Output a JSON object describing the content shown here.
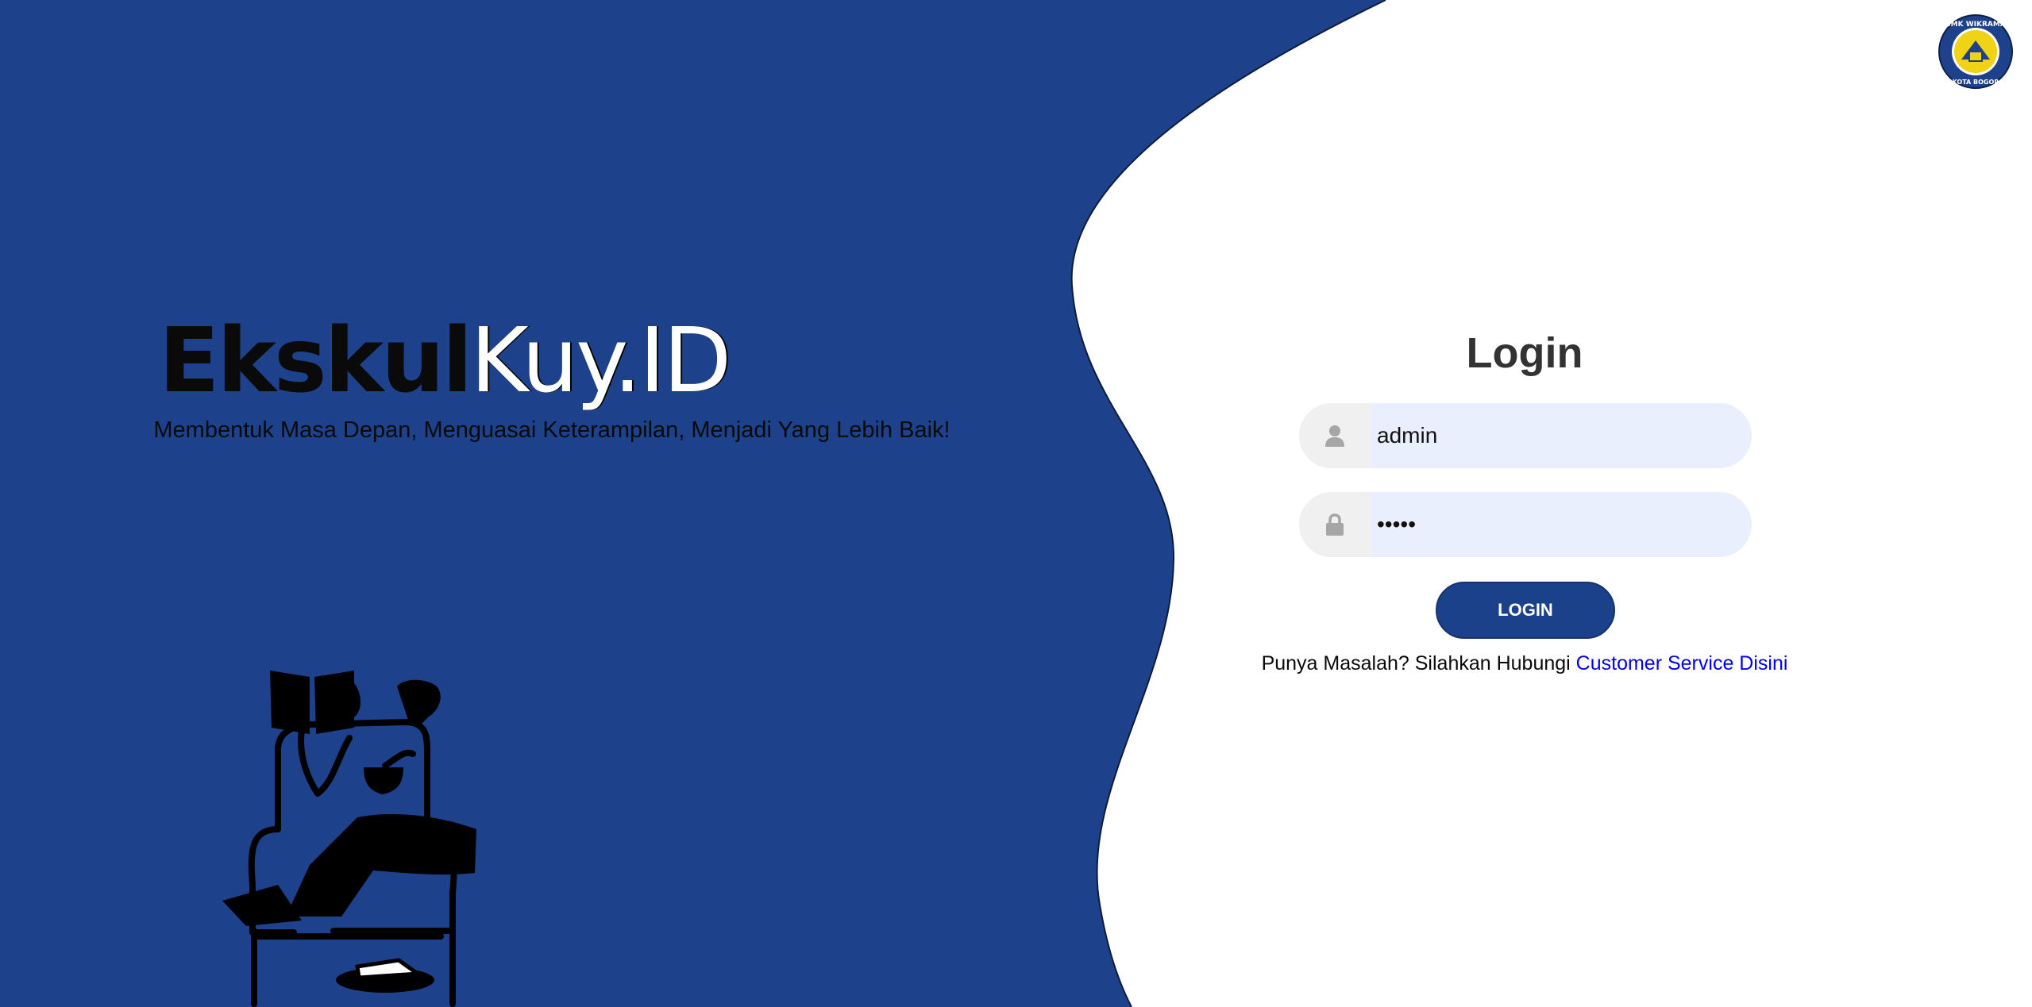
{
  "brand": {
    "title_part1": "Ekskul",
    "title_part2": "Kuy.ID",
    "tagline": "Membentuk Masa Depan, Menguasai Keterampilan, Menjadi Yang Lebih Baik!"
  },
  "login": {
    "title": "Login",
    "username": {
      "value": "admin",
      "icon": "user-icon"
    },
    "password": {
      "value": "admin",
      "icon": "lock-icon"
    },
    "button_label": "LOGIN",
    "help_text": "Punya Masalah? Silahkan Hubungi ",
    "help_link": "Customer Service Disini"
  },
  "logo": {
    "top_text": "SMK WIKRAMA",
    "bottom_text": "KOTA BOGOR"
  },
  "colors": {
    "primary_blue": "#1d428b",
    "link": "#0000ee",
    "field_bg": "#e9effc"
  }
}
